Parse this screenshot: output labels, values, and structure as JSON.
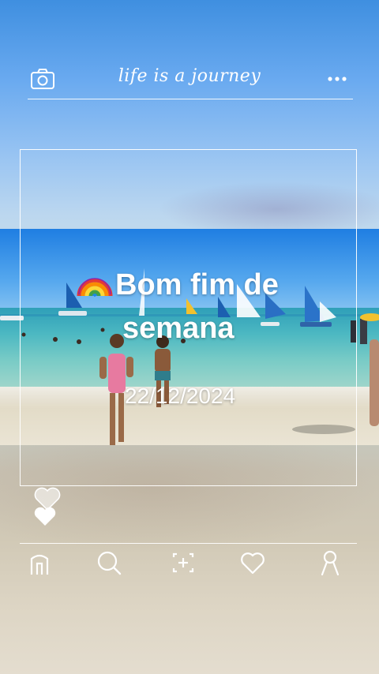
{
  "header": {
    "title": "life is a journey",
    "camera_icon": "camera-icon",
    "more_icon": "more-dots-icon"
  },
  "post": {
    "emoji": "🌈",
    "line1": "Bom fim de",
    "line2": "semana",
    "date": "22/12/2024"
  },
  "reactions": {
    "outline_icon": "heart-outline-icon",
    "filled_icon": "heart-filled-icon"
  },
  "nav": {
    "items": [
      {
        "icon": "home-icon"
      },
      {
        "icon": "search-icon"
      },
      {
        "icon": "add-frame-icon"
      },
      {
        "icon": "heart-icon"
      },
      {
        "icon": "profile-icon"
      }
    ]
  },
  "colors": {
    "ui_white": "#ffffff",
    "sky_blue": "#1f7ee2"
  }
}
